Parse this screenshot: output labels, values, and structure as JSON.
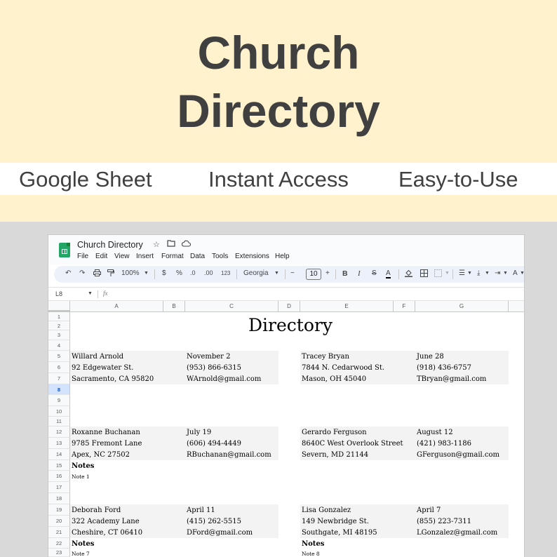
{
  "banner": {
    "title_line1": "Church",
    "title_line2": "Directory",
    "features": [
      "Google Sheet",
      "Instant Access",
      "Easy-to-Use"
    ],
    "background": "#fff2cc"
  },
  "sheet": {
    "doc_title": "Church Directory",
    "menu": [
      "File",
      "Edit",
      "View",
      "Insert",
      "Format",
      "Data",
      "Tools",
      "Extensions",
      "Help"
    ],
    "toolbar": {
      "zoom": "100%",
      "currency": "$",
      "percent": "%",
      "decrease_decimals": ".0",
      "increase_decimals": ".00",
      "more_formats": "123",
      "font": "Georgia",
      "font_size": "10",
      "minus": "−",
      "plus": "+",
      "bold": "B",
      "italic": "I",
      "strikethrough": "S",
      "text_color": "A"
    },
    "name_box": "L8",
    "fx_label": "fx",
    "columns": [
      "A",
      "B",
      "C",
      "D",
      "E",
      "F",
      "G"
    ],
    "rows": [
      "1",
      "2",
      "3",
      "4",
      "5",
      "6",
      "7",
      "8",
      "9",
      "10",
      "11",
      "12",
      "13",
      "14",
      "15",
      "16",
      "17",
      "18",
      "19",
      "20",
      "21",
      "22",
      "23"
    ],
    "selected_row": "8",
    "heading": "Directory",
    "entries": [
      {
        "name": "Willard Arnold",
        "street": "92 Edgewater St.",
        "city": "Sacramento, CA 95820",
        "date": "November 2",
        "phone": "(953) 866-6315",
        "email": "WArnold@gmail.com"
      },
      {
        "name": "Tracey Bryan",
        "street": "7844 N. Cedarwood St.",
        "city": "Mason, OH 45040",
        "date": "June 28",
        "phone": "(918) 436-6757",
        "email": "TBryan@gmail.com"
      },
      {
        "name": "Roxanne Buchanan",
        "street": "9785 Fremont Lane",
        "city": "Apex, NC 27502",
        "date": "July 19",
        "phone": "(606) 494-4449",
        "email": "RBuchanan@gmail.com",
        "notes_label": "Notes",
        "note": "Note 1"
      },
      {
        "name": "Gerardo Ferguson",
        "street": "8640C West Overlook Street",
        "city": "Severn, MD 21144",
        "date": "August 12",
        "phone": "(421) 983-1186",
        "email": "GFerguson@gmail.com"
      },
      {
        "name": "Deborah Ford",
        "street": "322 Academy Lane",
        "city": "Cheshire, CT 06410",
        "date": "April 11",
        "phone": "(415) 262-5515",
        "email": "DFord@gmail.com",
        "notes_label": "Notes",
        "note": "Note 7"
      },
      {
        "name": "Lisa Gonzalez",
        "street": "149 Newbridge St.",
        "city": "Southgate, MI 48195",
        "date": "April 7",
        "phone": "(855) 223-7311",
        "email": "LGonzalez@gmail.com",
        "notes_label": "Notes",
        "note": "Note 8"
      }
    ]
  }
}
